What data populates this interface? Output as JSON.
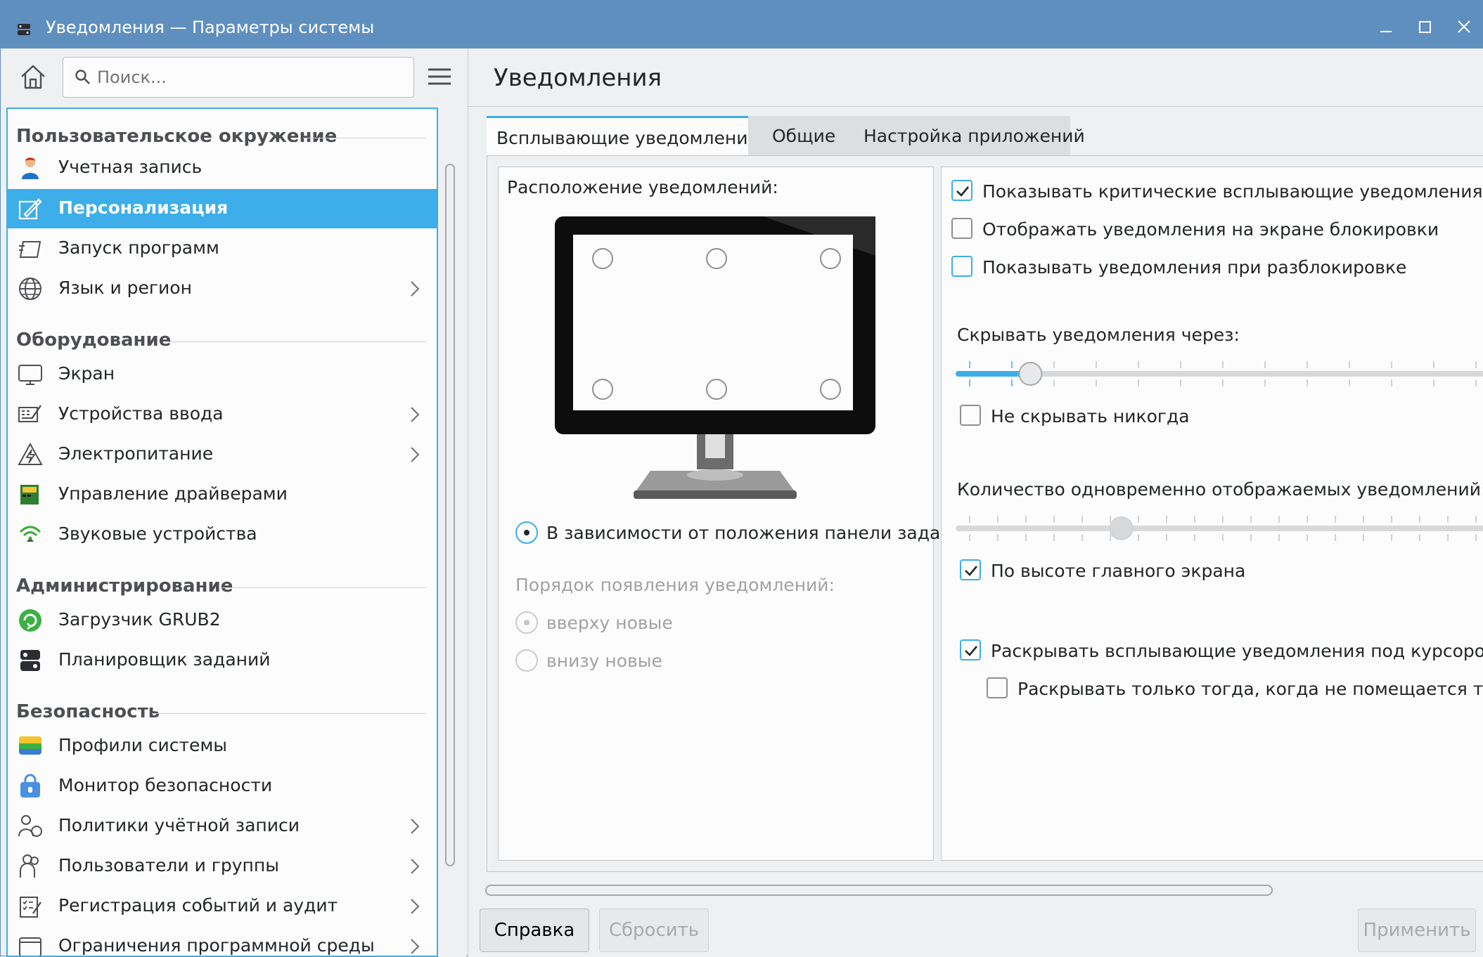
{
  "window": {
    "title": "Уведомления — Параметры системы",
    "controls": [
      "minimize",
      "maximize",
      "close"
    ]
  },
  "sidebar": {
    "search_placeholder": "Поиск...",
    "groups": [
      {
        "label": "Пользовательское окружение"
      },
      {
        "label": "Оборудование"
      },
      {
        "label": "Администрирование"
      },
      {
        "label": "Безопасность"
      }
    ],
    "items": [
      {
        "label": "Учетная запись",
        "icon": "user-icon"
      },
      {
        "label": "Персонализация",
        "icon": "brush-icon",
        "selected": true
      },
      {
        "label": "Запуск программ",
        "icon": "launch-icon"
      },
      {
        "label": "Язык и регион",
        "icon": "globe-icon",
        "arrow": true
      },
      {
        "label": "Экран",
        "icon": "display-icon"
      },
      {
        "label": "Устройства ввода",
        "icon": "keyboard-icon",
        "arrow": true
      },
      {
        "label": "Электропитание",
        "icon": "power-icon",
        "arrow": true
      },
      {
        "label": "Управление драйверами",
        "icon": "driver-icon"
      },
      {
        "label": "Звуковые устройства",
        "icon": "sound-icon"
      },
      {
        "label": "Загрузчик GRUB2",
        "icon": "grub-icon"
      },
      {
        "label": "Планировщик заданий",
        "icon": "scheduler-icon"
      },
      {
        "label": "Профили системы",
        "icon": "profiles-icon"
      },
      {
        "label": "Монитор безопасности",
        "icon": "lock-icon"
      },
      {
        "label": "Политики учётной записи",
        "icon": "users-policy-icon",
        "arrow": true
      },
      {
        "label": "Пользователи и группы",
        "icon": "users-icon",
        "arrow": true
      },
      {
        "label": "Регистрация событий и аудит",
        "icon": "audit-icon",
        "arrow": true
      },
      {
        "label": "Ограничения программной среды",
        "icon": "restrict-icon",
        "arrow": true
      }
    ]
  },
  "main": {
    "title": "Уведомления",
    "tabs": [
      {
        "label": "Всплывающие уведомления",
        "active": true
      },
      {
        "label": "Общие"
      },
      {
        "label": "Настройка приложений"
      }
    ],
    "position_label": "Расположение уведомлений:",
    "position_radio": "В зависимости от положения панели задач",
    "order_label": "Порядок появления уведомлений:",
    "order_options": [
      "вверху новые",
      "внизу новые"
    ],
    "checks": {
      "critical": {
        "label": "Показывать критические всплывающие уведомления в ре",
        "checked": true
      },
      "lockscreen": {
        "label": "Отображать уведомления на экране блокировки",
        "checked": false
      },
      "unlock": {
        "label": "Показывать уведомления при разблокировке",
        "checked": false
      },
      "never_hide": {
        "label": "Не скрывать никогда",
        "checked": false
      },
      "by_height": {
        "label": "По высоте главного экрана",
        "checked": true
      },
      "expand": {
        "label": "Раскрывать всплывающие уведомления под курсором мы",
        "checked": true
      },
      "expand_only": {
        "label": "Раскрывать только тогда, когда не помещается текст",
        "checked": false
      }
    },
    "hide_label": "Скрывать уведомления через:",
    "hide_slider_level": 0.14,
    "count_label": "Количество одновременно отображаемых уведомлений:  По",
    "count_slider_level": 0.31
  },
  "buttons": {
    "help": "Справка",
    "reset": "Сбросить",
    "apply": "Применить"
  },
  "colors": {
    "accent": "#3daee9",
    "titlebar": "#5f8fbf"
  }
}
